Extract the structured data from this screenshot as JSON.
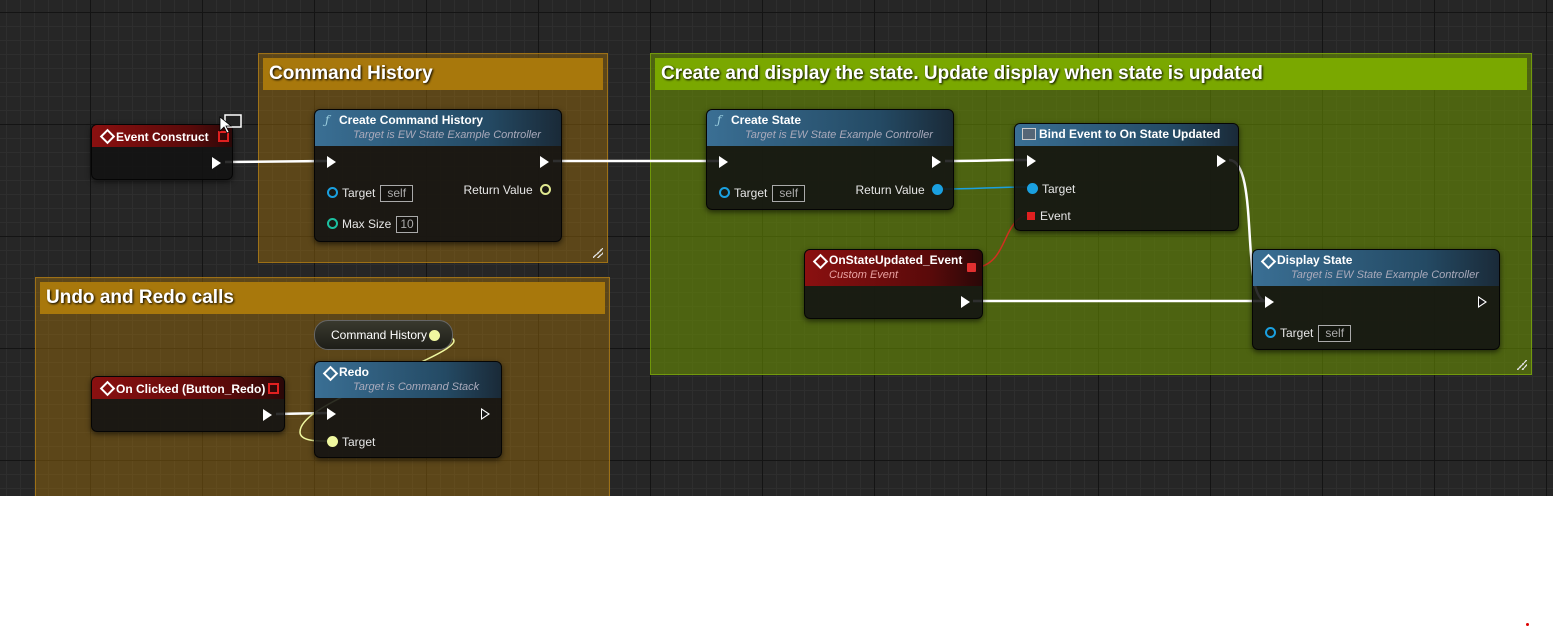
{
  "comments": {
    "command_history": "Command History",
    "create_display": "Create and display the state. Update display when state is updated",
    "undo_redo": "Undo and Redo calls"
  },
  "nodes": {
    "event_construct": {
      "title": "Event Construct"
    },
    "create_command_history": {
      "title": "Create Command History",
      "subtitle": "Target is EW State Example Controller",
      "target_label": "Target",
      "target_value": "self",
      "max_size_label": "Max Size",
      "max_size_value": "10",
      "return_label": "Return Value"
    },
    "create_state": {
      "title": "Create State",
      "subtitle": "Target is EW State Example Controller",
      "target_label": "Target",
      "target_value": "self",
      "return_label": "Return Value"
    },
    "bind_event": {
      "title": "Bind Event to On State Updated",
      "target_label": "Target",
      "event_label": "Event"
    },
    "on_state_updated": {
      "title": "OnStateUpdated_Event",
      "subtitle": "Custom Event"
    },
    "display_state": {
      "title": "Display State",
      "subtitle": "Target is EW State Example Controller",
      "target_label": "Target",
      "target_value": "self"
    },
    "command_history_var": {
      "label": "Command History"
    },
    "on_clicked_redo": {
      "title": "On Clicked (Button_Redo)"
    },
    "redo": {
      "title": "Redo",
      "subtitle": "Target is Command Stack",
      "target_label": "Target"
    }
  },
  "colors": {
    "comment_orange": "#a8780c",
    "comment_green": "#7aa800",
    "event_header": "#8a1010",
    "function_header": "#3a6f94",
    "object_pin": "#1aa0e0",
    "struct_pin": "#e0e890",
    "delegate_pin": "#e02020"
  }
}
